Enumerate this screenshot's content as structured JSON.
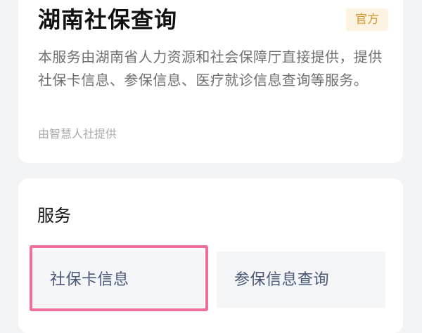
{
  "info_card": {
    "title": "湖南社保查询",
    "badge": "官方",
    "description": "本服务由湖南省人力资源和社会保障厅直接提供，提供社保卡信息、参保信息、医疗就诊信息查询等服务。",
    "provider": "由智慧人社提供"
  },
  "services": {
    "heading": "服务",
    "items": [
      {
        "label": "社保卡信息"
      },
      {
        "label": "参保信息查询"
      }
    ]
  },
  "colors": {
    "badge_bg": "#fdf3e3",
    "badge_text": "#d5962e",
    "highlight_border": "#ef6f99",
    "tile_text": "#4a5676"
  }
}
